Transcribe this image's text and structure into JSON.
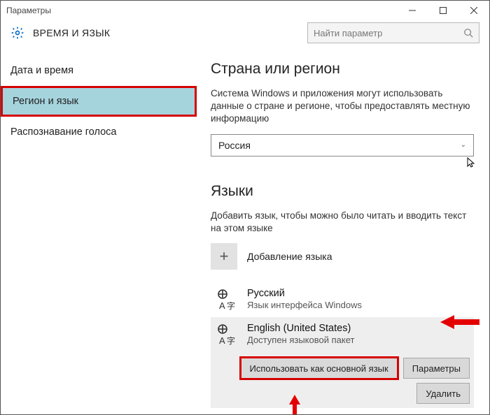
{
  "titlebar": {
    "title": "Параметры"
  },
  "header": {
    "title": "ВРЕМЯ И ЯЗЫК",
    "search_placeholder": "Найти параметр"
  },
  "sidebar": {
    "items": [
      {
        "label": "Дата и время"
      },
      {
        "label": "Регион и язык"
      },
      {
        "label": "Распознавание голоса"
      }
    ]
  },
  "content": {
    "region_heading": "Страна или регион",
    "region_desc": "Система Windows и приложения могут использовать данные о стране и регионе, чтобы предоставлять местную информацию",
    "region_selected": "Россия",
    "lang_heading": "Языки",
    "lang_desc": "Добавить язык, чтобы можно было читать и вводить текст на этом языке",
    "add_lang_label": "Добавление языка",
    "languages": [
      {
        "name": "Русский",
        "sub": "Язык интерфейса Windows"
      },
      {
        "name": "English (United States)",
        "sub": "Доступен языковой пакет"
      }
    ],
    "actions": {
      "set_default": "Использовать как основной язык",
      "options": "Параметры",
      "remove": "Удалить"
    }
  }
}
